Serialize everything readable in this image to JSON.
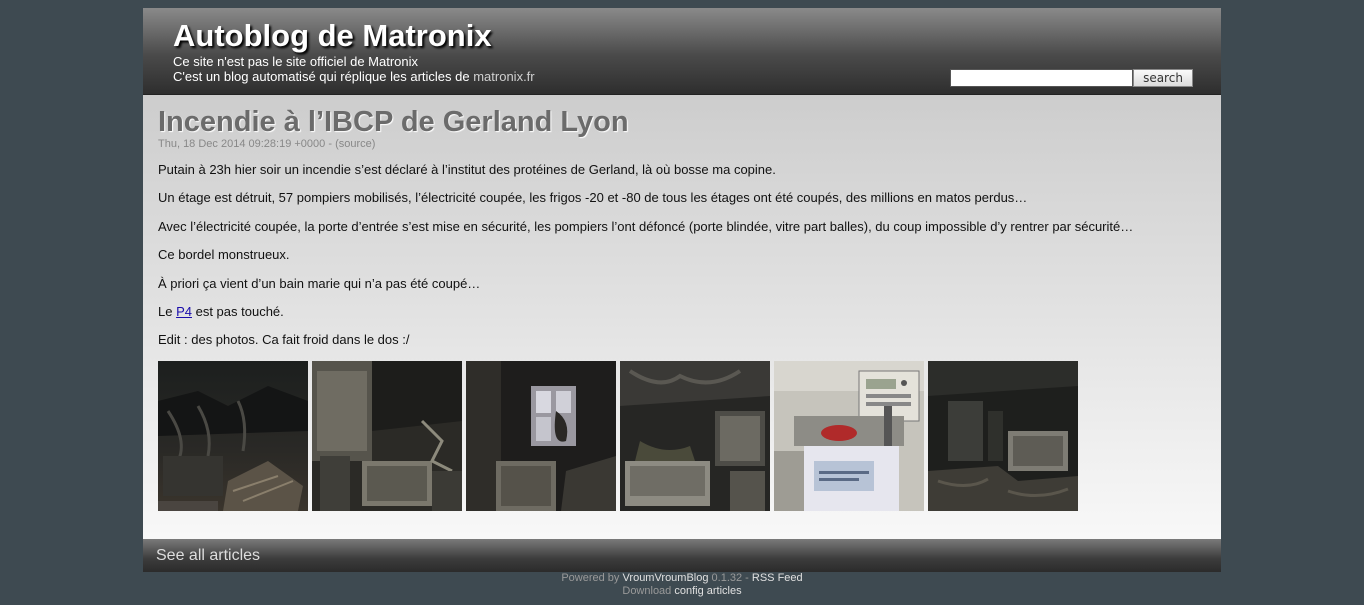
{
  "header": {
    "title": "Autoblog de Matronix",
    "subtitle_line1": "Ce site n'est pas le site officiel de Matronix",
    "subtitle_line2_prefix": "C'est un blog automatisé qui réplique les articles de ",
    "subtitle_link": "matronix.fr"
  },
  "search": {
    "value": "",
    "button_label": "search"
  },
  "article": {
    "title": "Incendie à l’IBCP de Gerland Lyon",
    "date": "Thu, 18 Dec 2014 09:28:19 +0000 - ",
    "source_link": "(source)",
    "paragraphs": {
      "p1": "Putain à 23h hier soir un incendie s’est déclaré à l’institut des protéines de Gerland, là où bosse ma copine.",
      "p2": "Un étage est détruit, 57 pompiers mobilisés, l’électricité coupée, les frigos -20 et -80 de tous les étages ont été coupés, des millions en matos perdus…",
      "p3": "Avec l’électricité coupée, la porte d’entrée s’est mise en sécurité, les pompiers l’ont défoncé (porte blindée, vitre part balles), du coup impossible d’y rentrer par sécurité…",
      "p4": "Ce bordel monstrueux.",
      "p5": "À priori ça vient d’un bain marie qui n’a pas été coupé…",
      "p6_prefix": "Le ",
      "p6_link": "P4",
      "p6_suffix": " est pas touché.",
      "p7": "Edit : des photos. Ca fait froid dans le dos :/"
    }
  },
  "footer": {
    "see_all": "See all articles",
    "powered_by": "Powered by ",
    "engine_link": "VroumVroumBlog",
    "version": " 0.1.32 - ",
    "rss_link": "RSS Feed",
    "download_label": "Download ",
    "config_link": "config",
    "articles_link": "articles"
  }
}
